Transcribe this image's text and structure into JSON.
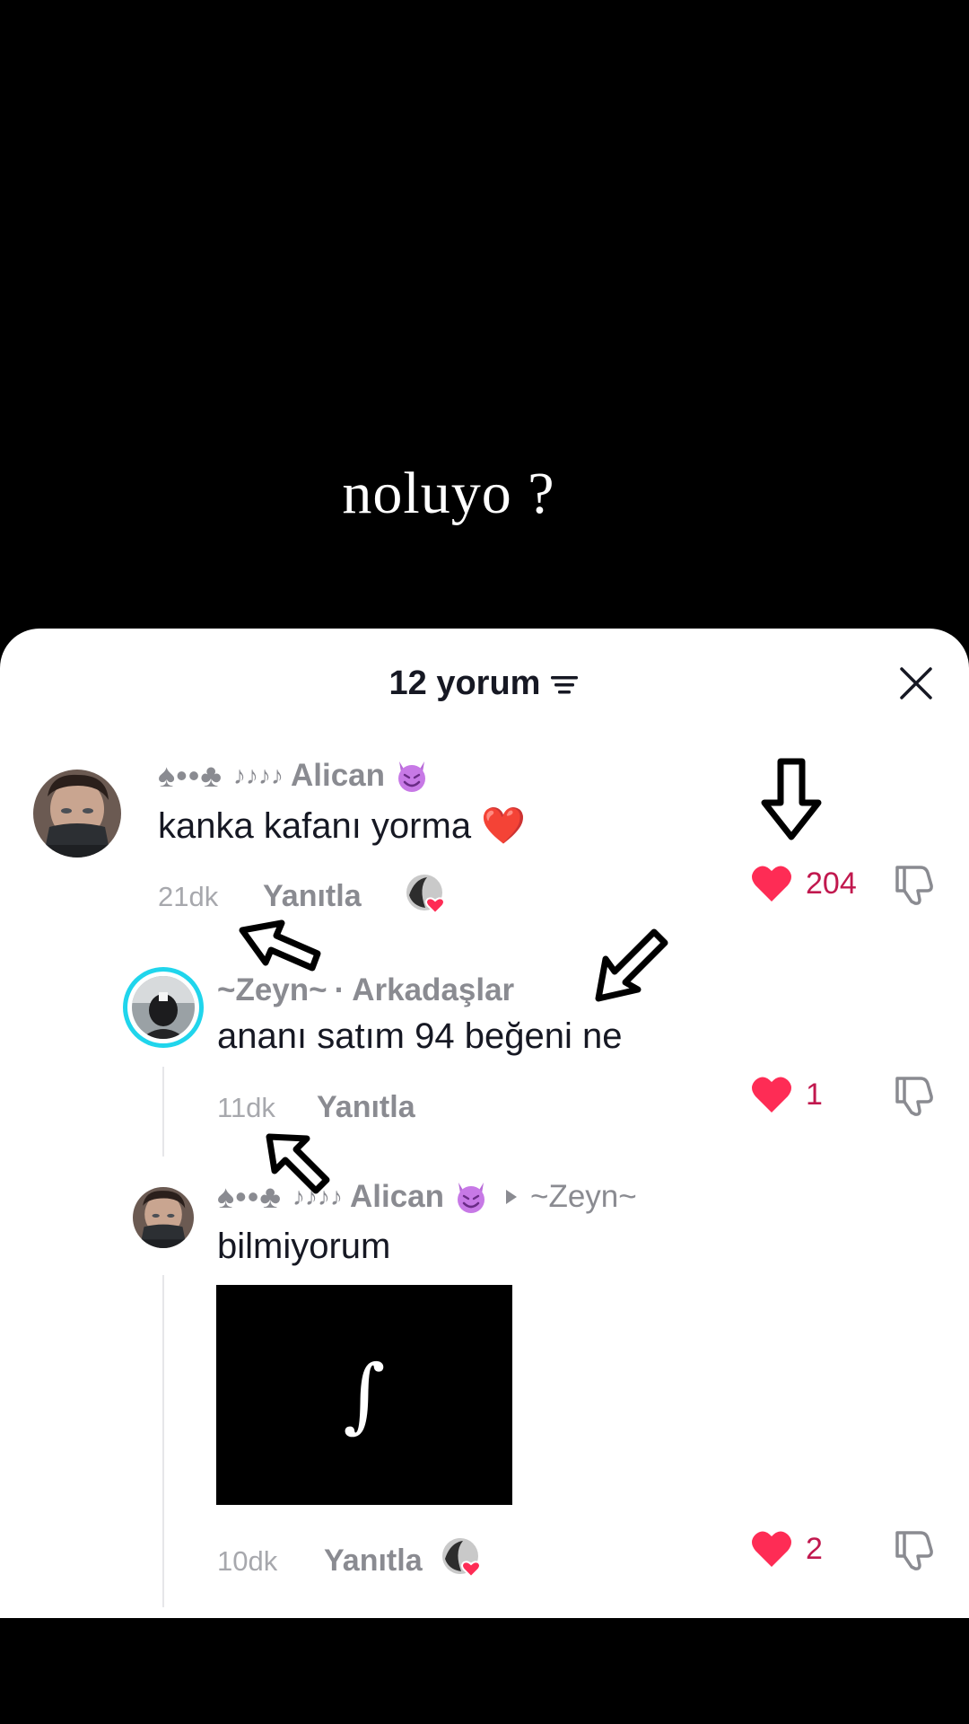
{
  "video": {
    "caption": "noluyo ?"
  },
  "header": {
    "title": "12 yorum"
  },
  "comments": [
    {
      "suits_prefix": "♠••♣",
      "notes": "♪♪♪♪",
      "username": "Alican",
      "text": "kanka kafanı yorma ❤️",
      "time": "21dk",
      "reply_label": "Yanıtla",
      "likes": "204"
    },
    {
      "username": "~Zeyn~",
      "tag": "Arkadaşlar",
      "text": "ananı satım 94 beğeni ne",
      "time": "11dk",
      "reply_label": "Yanıtla",
      "likes": "1"
    },
    {
      "suits_prefix": "♠••♣",
      "notes": "♪♪♪♪",
      "username": "Alican",
      "reply_to": "~Zeyn~",
      "text": "bilmiyorum",
      "image_glyph": "∫",
      "time": "10dk",
      "reply_label": "Yanıtla",
      "likes": "2"
    }
  ],
  "colors": {
    "like_red": "#fe2c55",
    "like_count": "#c1184e",
    "muted_text": "#8a8b91",
    "story_ring": "#20d5ec"
  },
  "icons": [
    "sort-icon",
    "close-icon",
    "devil-emoji-icon",
    "heart-icon",
    "dislike-icon",
    "reply-arrow-icon",
    "creator-liked-icon",
    "annotation-arrow"
  ]
}
